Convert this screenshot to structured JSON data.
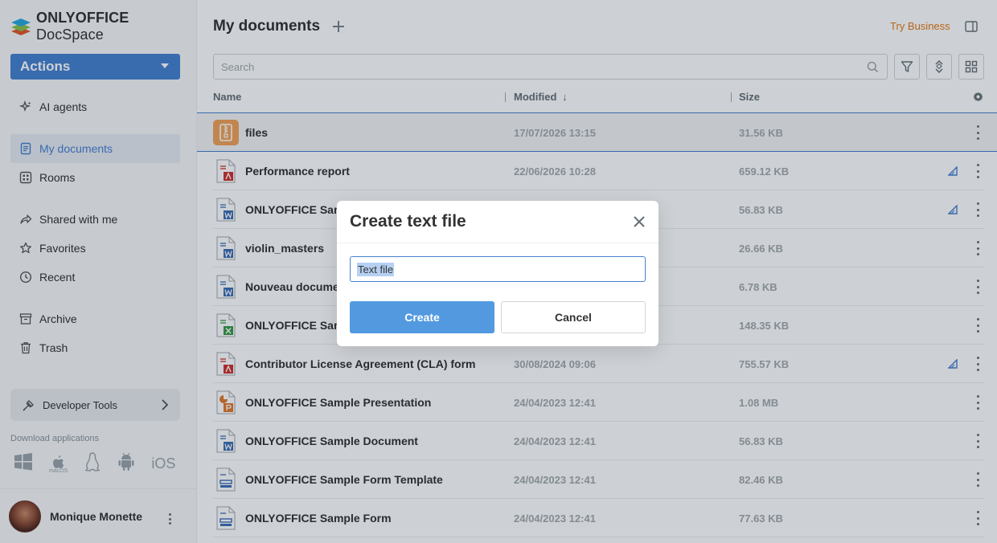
{
  "app": {
    "logo_bold": "ONLYOFFICE",
    "logo_light": " DocSpace",
    "actions_label": "Actions"
  },
  "sidebar": {
    "items": [
      {
        "label": "AI agents",
        "icon": "ai-sparkle-icon"
      },
      {
        "label": "My documents",
        "icon": "document-icon",
        "active": true
      },
      {
        "label": "Rooms",
        "icon": "rooms-grid-icon"
      },
      {
        "label": "Shared with me",
        "icon": "shared-icon"
      },
      {
        "label": "Favorites",
        "icon": "star-icon"
      },
      {
        "label": "Recent",
        "icon": "clock-icon"
      },
      {
        "label": "Archive",
        "icon": "archive-icon"
      },
      {
        "label": "Trash",
        "icon": "trash-icon"
      }
    ],
    "developer_tools": "Developer Tools",
    "download_label": "Download applications",
    "download_ios": "iOS",
    "download_macos": "macOS"
  },
  "user": {
    "name": "Monique Monette"
  },
  "header": {
    "title": "My documents",
    "try_business": "Try Business"
  },
  "search": {
    "placeholder": "Search"
  },
  "table": {
    "columns": {
      "name": "Name",
      "modified": "Modified",
      "size": "Size"
    },
    "rows": [
      {
        "name": "files",
        "modified": "17/07/2026 13:15",
        "size": "31.56 KB",
        "type": "archive"
      },
      {
        "name": "Performance report",
        "modified": "22/06/2026 10:28",
        "size": "659.12 KB",
        "type": "pdf"
      },
      {
        "name": "ONLYOFFICE Samp",
        "modified": "",
        "size": "56.83 KB",
        "type": "docx"
      },
      {
        "name": "violin_masters",
        "modified": "",
        "size": "26.66 KB",
        "type": "docx"
      },
      {
        "name": "Nouveau documen",
        "modified": "",
        "size": "6.78 KB",
        "type": "docx"
      },
      {
        "name": "ONLYOFFICE Samp",
        "modified": "",
        "size": "148.35 KB",
        "type": "xlsx"
      },
      {
        "name": "Contributor License Agreement (CLA) form",
        "modified": "30/08/2024 09:06",
        "size": "755.57 KB",
        "type": "pdf"
      },
      {
        "name": "ONLYOFFICE Sample Presentation",
        "modified": "24/04/2023 12:41",
        "size": "1.08 MB",
        "type": "pptx"
      },
      {
        "name": "ONLYOFFICE Sample Document",
        "modified": "24/04/2023 12:41",
        "size": "56.83 KB",
        "type": "docx"
      },
      {
        "name": "ONLYOFFICE Sample Form Template",
        "modified": "24/04/2023 12:41",
        "size": "82.46 KB",
        "type": "form"
      },
      {
        "name": "ONLYOFFICE Sample Form",
        "modified": "24/04/2023 12:41",
        "size": "77.63 KB",
        "type": "form"
      }
    ]
  },
  "dialog": {
    "title": "Create text file",
    "input_value": "Text file",
    "create_label": "Create",
    "cancel_label": "Cancel"
  },
  "colors": {
    "accent": "#4781d1",
    "create_button": "#5299e0",
    "try_business": "#e57b15",
    "pdf": "#d0312d",
    "docx": "#3d6fb5",
    "xlsx": "#3a9a4a",
    "pptx": "#e07a2e"
  }
}
